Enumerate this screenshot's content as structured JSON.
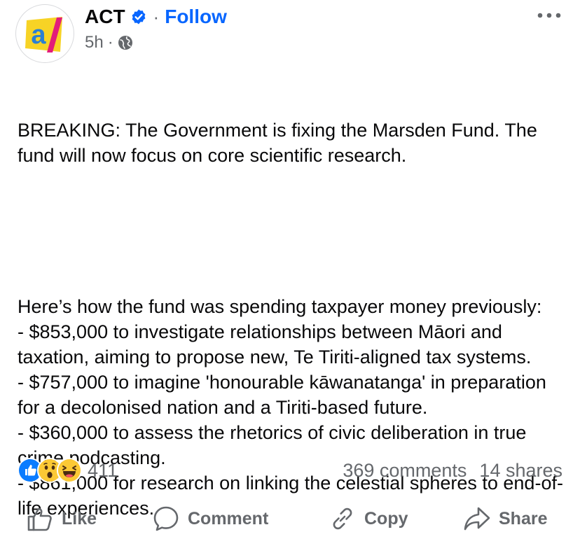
{
  "post": {
    "author": "ACT",
    "dot": "·",
    "follow_label": "Follow",
    "time": "5h",
    "time_sep": "·",
    "icons": {
      "avatar": "act-logo",
      "verified": "verified-badge-icon",
      "privacy": "globe-icon",
      "more": "more-options-icon"
    },
    "logo_colors": {
      "yellow": "#f7d325",
      "blue": "#2a7fd4",
      "pink": "#e21d7a"
    },
    "logo_text": "a/",
    "paragraphs": [
      "BREAKING: The Government is fixing the Marsden Fund. The fund will now focus on core scientific research.",
      "",
      "Here’s how the fund was spending taxpayer money previously:\n- $853,000 to investigate relationships between Māori and taxation, aiming to propose new, Te Tiriti-aligned tax systems.\n- $757,000 to imagine 'honourable kāwanatanga' in preparation for a decolonised nation and a Tiriti-based future.\n- $360,000 to assess the rhetorics of civic deliberation in true crime podcasting.\n- $861,000 for research on linking the celestial spheres to end-of-life experiences."
    ]
  },
  "stats": {
    "reactions": [
      "like-reaction-icon",
      "wow-reaction-icon",
      "haha-reaction-icon"
    ],
    "reaction_count": "411",
    "comments": "369 comments",
    "shares": "14 shares"
  },
  "actions": {
    "like": "Like",
    "comment": "Comment",
    "copy": "Copy",
    "share": "Share"
  },
  "colors": {
    "accent": "#0866ff",
    "secondary_text": "#65686c",
    "primary_text": "#080809"
  }
}
